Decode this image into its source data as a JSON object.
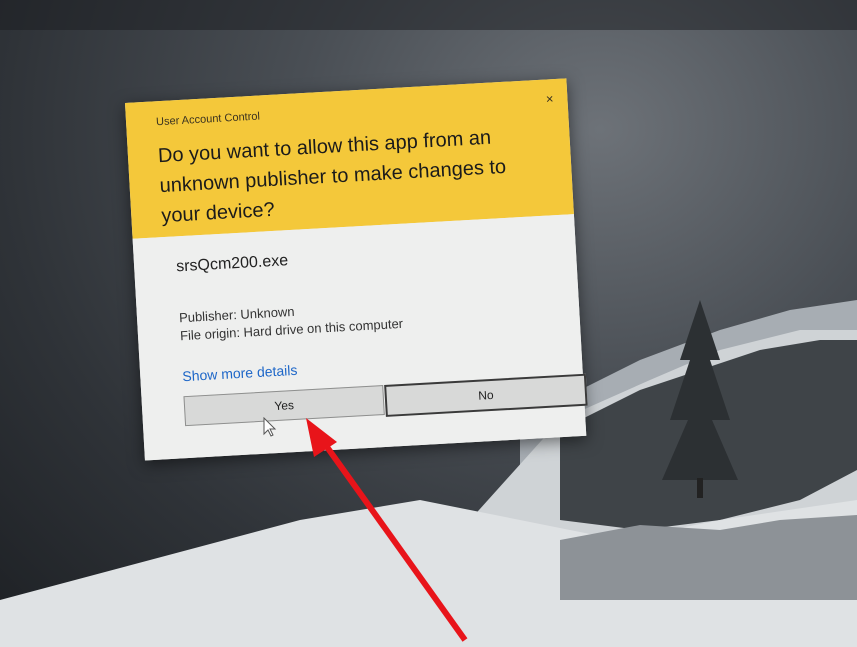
{
  "dialog": {
    "caption": "User Account Control",
    "close_label": "×",
    "question": "Do you want to allow this app from an unknown publisher to make changes to your device?",
    "program_name": "srsQcm200.exe",
    "publisher": "Publisher: Unknown",
    "file_origin": "File origin: Hard drive on this computer",
    "details_link": "Show more details",
    "yes_label": "Yes",
    "no_label": "No"
  },
  "colors": {
    "header": "#f4c83a",
    "body": "#eeefee",
    "link": "#1e67c8",
    "arrow": "#e8141a"
  }
}
